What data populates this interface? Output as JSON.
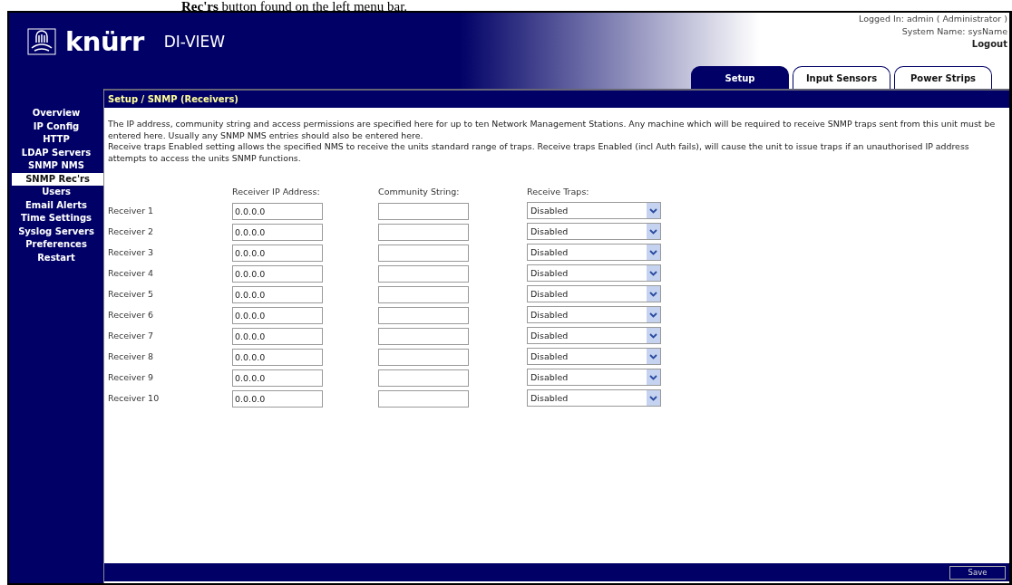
{
  "document_caption": "**Rec'rs** button found on the left menu bar.",
  "header": {
    "logo": "knürr",
    "product": "DI-VIEW",
    "logged_in": "Logged In: admin ( Administrator )",
    "system_name": "System Name: sysName",
    "logout": "Logout"
  },
  "tabs": [
    {
      "label": "Setup",
      "selected": true
    },
    {
      "label": "Input Sensors",
      "selected": false
    },
    {
      "label": "Power Strips",
      "selected": false
    }
  ],
  "sidebar": {
    "items": [
      {
        "label": "Overview",
        "selected": false
      },
      {
        "label": "IP Config",
        "selected": false
      },
      {
        "label": "HTTP",
        "selected": false
      },
      {
        "label": "LDAP Servers",
        "selected": false
      },
      {
        "label": "SNMP NMS",
        "selected": false
      },
      {
        "label": "SNMP Rec'rs",
        "selected": true
      },
      {
        "label": "Users",
        "selected": false
      },
      {
        "label": "Email Alerts",
        "selected": false
      },
      {
        "label": "Time Settings",
        "selected": false
      },
      {
        "label": "Syslog Servers",
        "selected": false
      },
      {
        "label": "Preferences",
        "selected": false
      },
      {
        "label": "Restart",
        "selected": false
      }
    ]
  },
  "page_title": "Setup / SNMP (Receivers)",
  "description": [
    "The IP address, community string and access permissions are specified here for up to ten Network Management Stations. Any machine which will be required to receive SNMP traps sent from this unit must be entered here. Usually any SNMP NMS entries should also be entered here.",
    "Receive traps Enabled setting allows the specified NMS to receive the units standard range of traps. Receive traps Enabled (incl Auth fails), will cause the unit to issue traps if an unauthorised IP address attempts to access the units SNMP functions."
  ],
  "columns": [
    "Receiver IP Address:",
    "Community String:",
    "Receive Traps:"
  ],
  "receivers": [
    {
      "label": "Receiver 1",
      "ip": "0.0.0.0",
      "traps": "Disabled"
    },
    {
      "label": "Receiver 2",
      "ip": "0.0.0.0",
      "traps": "Disabled"
    },
    {
      "label": "Receiver 3",
      "ip": "0.0.0.0",
      "traps": "Disabled"
    },
    {
      "label": "Receiver 4",
      "ip": "0.0.0.0",
      "traps": "Disabled"
    },
    {
      "label": "Receiver 5",
      "ip": "0.0.0.0",
      "traps": "Disabled"
    },
    {
      "label": "Receiver 6",
      "ip": "0.0.0.0",
      "traps": "Disabled"
    },
    {
      "label": "Receiver 7",
      "ip": "0.0.0.0",
      "traps": "Disabled"
    },
    {
      "label": "Receiver 8",
      "ip": "0.0.0.0",
      "traps": "Disabled"
    },
    {
      "label": "Receiver 9",
      "ip": "0.0.0.0",
      "traps": "Disabled"
    },
    {
      "label": "Receiver 10",
      "ip": "0.0.0.0",
      "traps": "Disabled"
    }
  ],
  "save": "Save"
}
